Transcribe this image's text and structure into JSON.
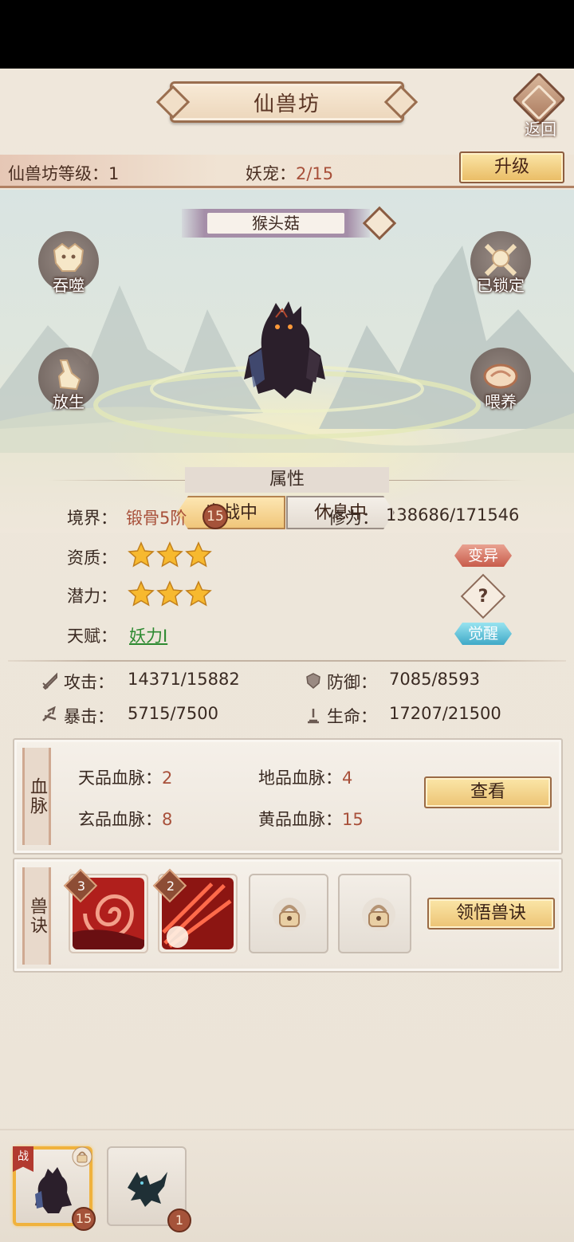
{
  "header": {
    "title": "仙兽坊",
    "back_label": "返回"
  },
  "level_bar": {
    "level_label": "仙兽坊等级：",
    "level_value": "1",
    "pet_label": "妖宠：",
    "pet_value": "2/15",
    "upgrade_label": "升级"
  },
  "pet": {
    "name": "猴头菇",
    "actions": {
      "devour": "吞噬",
      "locked": "已锁定",
      "release": "放生",
      "feed": "喂养"
    },
    "status": {
      "active": "出战中",
      "resting": "休息中"
    }
  },
  "attributes": {
    "section_title": "属性",
    "realm_label": "境界：",
    "realm_value": "锻骨5阶",
    "realm_level": "15",
    "cultivation_label": "修为：",
    "cultivation_value": "138686/171546",
    "aptitude_label": "资质：",
    "aptitude_stars": 3,
    "potential_label": "潜力：",
    "potential_stars": 3,
    "talent_label": "天赋：",
    "talent_value": "妖力I",
    "mutate_label": "变异",
    "help_label": "?",
    "awaken_label": "觉醒",
    "attack_label": "攻击：",
    "attack_value": "14371/15882",
    "defense_label": "防御：",
    "defense_value": "7085/8593",
    "crit_label": "暴击：",
    "crit_value": "5715/7500",
    "hp_label": "生命：",
    "hp_value": "17207/21500"
  },
  "bloodline": {
    "side_label": "血脉",
    "heaven_label": "天品血脉：",
    "heaven_value": "2",
    "earth_label": "地品血脉：",
    "earth_value": "4",
    "mystic_label": "玄品血脉：",
    "mystic_value": "8",
    "yellow_label": "黄品血脉：",
    "yellow_value": "15",
    "view_label": "查看"
  },
  "skills": {
    "side_label": "兽诀",
    "slot1_level": "3",
    "slot2_level": "2",
    "learn_label": "领悟兽诀"
  },
  "bottom": {
    "pet1_flag": "战",
    "pet1_level": "15",
    "pet2_level": "1"
  },
  "colors": {
    "accent_red": "#a8503a",
    "talent_green": "#2d8a31",
    "gold": "#ecc374"
  },
  "icons": [
    "back-icon",
    "rename-icon",
    "wolf-head-icon",
    "lock-chain-icon",
    "rabbit-icon",
    "meat-icon",
    "star-icon",
    "sword-icon",
    "shield-icon",
    "crit-icon",
    "heart-icon",
    "lock-icon"
  ]
}
